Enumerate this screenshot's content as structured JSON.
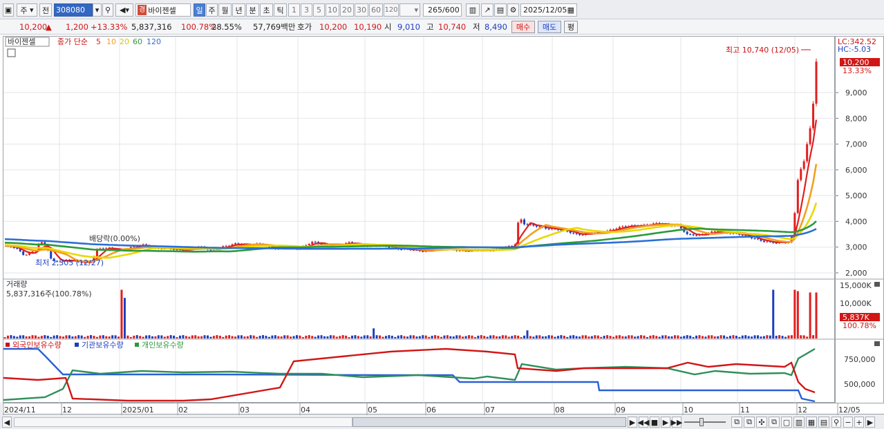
{
  "toolbar": {
    "market": "주",
    "jeon": "전",
    "code": "308080",
    "tag": "경",
    "name": "바이젠셀",
    "periods": [
      "일",
      "주",
      "월",
      "년",
      "분",
      "초",
      "틱"
    ],
    "minutes": [
      "1",
      "3",
      "5",
      "10",
      "20",
      "30",
      "60",
      "120"
    ],
    "count": "265",
    "count_max": "/600",
    "date": "2025/12/05"
  },
  "info": {
    "price": "10,200",
    "change": "1,200",
    "change_pct": "+13.33%",
    "volume": "5,837,316",
    "vol_ratio": "100.78%",
    "turnover": "28.55%",
    "amount": "57,769백만",
    "hoga_label": "호가",
    "ask": "10,200",
    "bid": "10,190",
    "open_label": "시",
    "open": "9,010",
    "high_label": "고",
    "high": "10,740",
    "low_label": "저",
    "low": "8,490",
    "buy": "매수",
    "sell": "매도",
    "eval": "평"
  },
  "legend": {
    "stock_name": "바이젠셀",
    "ma_label": "종가 단순",
    "ma_periods": [
      "5",
      "10",
      "20",
      "60",
      "120"
    ],
    "ma_colors": [
      "#e01e1e",
      "#f0a020",
      "#e8d800",
      "#2b9a3a",
      "#2a6fd6"
    ]
  },
  "price_chart": {
    "high_note": "최고 10,740 (12/05)",
    "low_note": "최저 2,305 (12/27)",
    "event_note": "배당락(0.00%)",
    "lc": "LC:342.52",
    "hc": "HC:-5.03",
    "cur_price": "10,200",
    "cur_pct": "13.33%",
    "y_ticks": [
      "9,000",
      "8,000",
      "7,000",
      "6,000",
      "5,000",
      "4,000",
      "3,000",
      "2,000"
    ]
  },
  "volume_chart": {
    "title": "거래량",
    "value_label": "5,837,316주(100.78%)",
    "cur_label": "5,837K",
    "cur_pct": "100.78%",
    "y_ticks": [
      "15,000K",
      "10,000K"
    ]
  },
  "holder_chart": {
    "series": [
      "외국인보유수량",
      "기관보유수량",
      "개인보유수량"
    ],
    "y_ticks": [
      "750,000",
      "500,000"
    ]
  },
  "date_axis": [
    "2024/11",
    "12",
    "2025/01",
    "02",
    "03",
    "04",
    "05",
    "06",
    "07",
    "08",
    "09",
    "10",
    "11",
    "12",
    "12/05"
  ]
}
